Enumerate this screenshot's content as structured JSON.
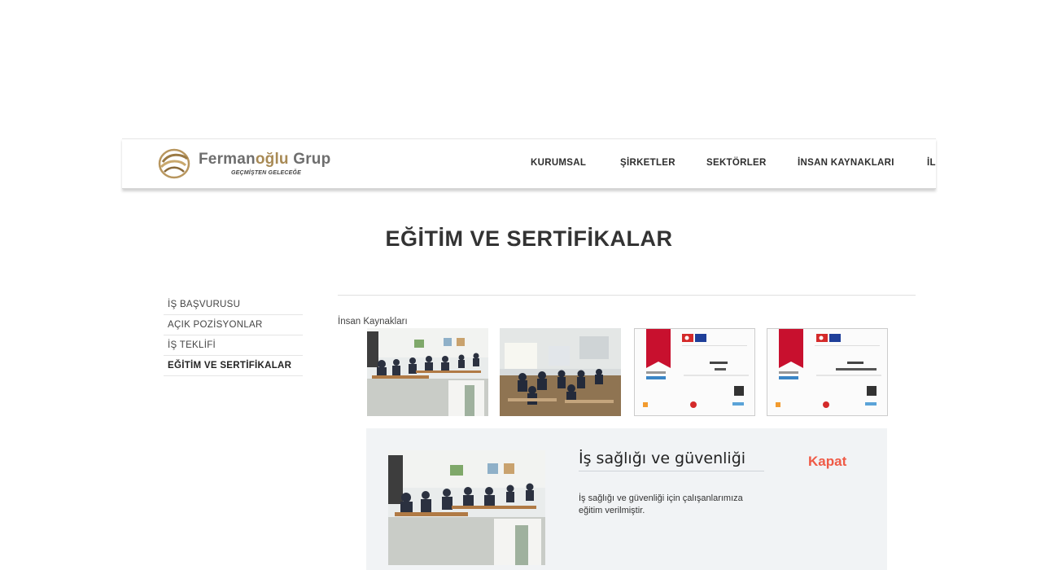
{
  "header": {
    "brand_gray": "Ferman",
    "brand_gold": "oğlu",
    "brand_rest": " Grup",
    "tagline": "GEÇMİŞTEN GELECEĞE",
    "logo_icon": "gold-swirl-logo",
    "nav": [
      "KURUMSAL",
      "ŞİRKETLER",
      "SEKTÖRLER",
      "İNSAN KAYNAKLARI",
      "İL"
    ]
  },
  "page": {
    "title": "EĞİTİM VE SERTİFİKALAR"
  },
  "sidebar": {
    "items": [
      "İŞ BAŞVURUSU",
      "AÇIK POZİSYONLAR",
      "İŞ TEKLİFİ",
      "EĞİTİM VE SERTİFİKALAR"
    ],
    "active": "EĞİTİM VE SERTİFİKALAR"
  },
  "content": {
    "breadcrumb": "İnsan Kaynakları",
    "gallery": [
      {
        "type": "photo",
        "icon": "classroom-photo"
      },
      {
        "type": "photo",
        "icon": "classroom-projector-photo"
      },
      {
        "type": "certificate",
        "icon": "certificate-image"
      },
      {
        "type": "certificate",
        "icon": "certificate-image"
      }
    ]
  },
  "detail": {
    "title": "İş sağlığı ve güvenliği",
    "close_label": "Kapat",
    "description": "İş sağlığı ve güvenliği için çalışanlarımıza eğitim verilmiştir."
  },
  "colors": {
    "accent_close": "#ef5a46",
    "logo_gold": "#a88a55",
    "panel_bg": "#f1f3f5",
    "cert_red": "#c8102e"
  }
}
